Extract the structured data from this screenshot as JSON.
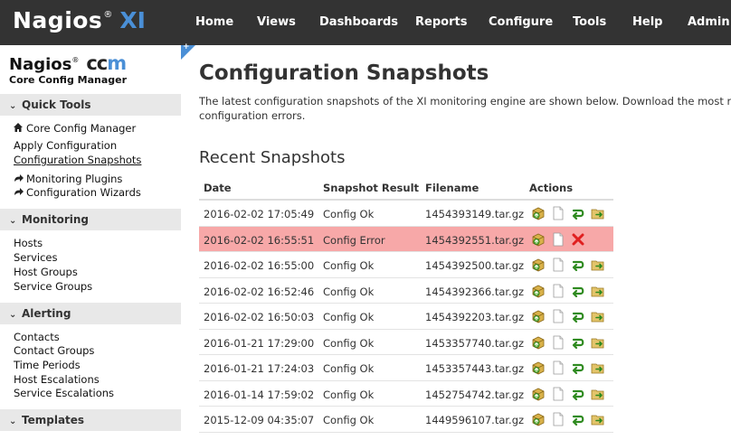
{
  "header": {
    "logo_text": "Nagios",
    "logo_reg": "®",
    "logo_suffix": "XI",
    "nav": [
      "Home",
      "Views",
      "Dashboards",
      "Reports",
      "Configure",
      "Tools",
      "Help",
      "Admin"
    ]
  },
  "sidebar": {
    "ccm_logo_nagios": "Nagios",
    "ccm_logo_reg": "®",
    "ccm_logo_cc": "cc",
    "ccm_logo_m": "m",
    "ccm_subtitle": "Core Config Manager",
    "sections": [
      {
        "title": "Quick Tools",
        "items": [
          {
            "label": "Core Config Manager",
            "icon": "home-icon"
          },
          {
            "label": "Apply Configuration"
          },
          {
            "label": "Configuration Snapshots",
            "active": true
          },
          {
            "label": "Monitoring Plugins",
            "icon": "share-arrow-icon"
          },
          {
            "label": "Configuration Wizards",
            "icon": "share-arrow-icon"
          }
        ]
      },
      {
        "title": "Monitoring",
        "items": [
          {
            "label": "Hosts"
          },
          {
            "label": "Services"
          },
          {
            "label": "Host Groups"
          },
          {
            "label": "Service Groups"
          }
        ]
      },
      {
        "title": "Alerting",
        "items": [
          {
            "label": "Contacts"
          },
          {
            "label": "Contact Groups"
          },
          {
            "label": "Time Periods"
          },
          {
            "label": "Host Escalations"
          },
          {
            "label": "Service Escalations"
          }
        ]
      },
      {
        "title": "Templates",
        "items": []
      }
    ]
  },
  "main": {
    "title": "Configuration Snapshots",
    "intro_line1": "The latest configuration snapshots of the XI monitoring engine are shown below. Download the most re",
    "intro_line2": "configuration errors.",
    "subtitle": "Recent Snapshots",
    "columns": [
      "Date",
      "Snapshot Result",
      "Filename",
      "Actions"
    ],
    "rows": [
      {
        "date": "2016-02-02 17:05:49",
        "result": "Config Ok",
        "file": "1454393149.tar.gz",
        "error": false
      },
      {
        "date": "2016-02-02 16:55:51",
        "result": "Config Error",
        "file": "1454392551.tar.gz",
        "error": true
      },
      {
        "date": "2016-02-02 16:55:00",
        "result": "Config Ok",
        "file": "1454392500.tar.gz",
        "error": false
      },
      {
        "date": "2016-02-02 16:52:46",
        "result": "Config Ok",
        "file": "1454392366.tar.gz",
        "error": false
      },
      {
        "date": "2016-02-02 16:50:03",
        "result": "Config Ok",
        "file": "1454392203.tar.gz",
        "error": false
      },
      {
        "date": "2016-01-21 17:29:00",
        "result": "Config Ok",
        "file": "1453357740.tar.gz",
        "error": false
      },
      {
        "date": "2016-01-21 17:24:03",
        "result": "Config Ok",
        "file": "1453357443.tar.gz",
        "error": false
      },
      {
        "date": "2016-01-14 17:59:02",
        "result": "Config Ok",
        "file": "1452754742.tar.gz",
        "error": false
      },
      {
        "date": "2015-12-09 04:35:07",
        "result": "Config Ok",
        "file": "1449596107.tar.gz",
        "error": false
      }
    ]
  },
  "colors": {
    "topbar": "#333333",
    "accent": "#4a8fd6",
    "error_row": "#f7a8a8",
    "section_header": "#e8e8e8"
  }
}
